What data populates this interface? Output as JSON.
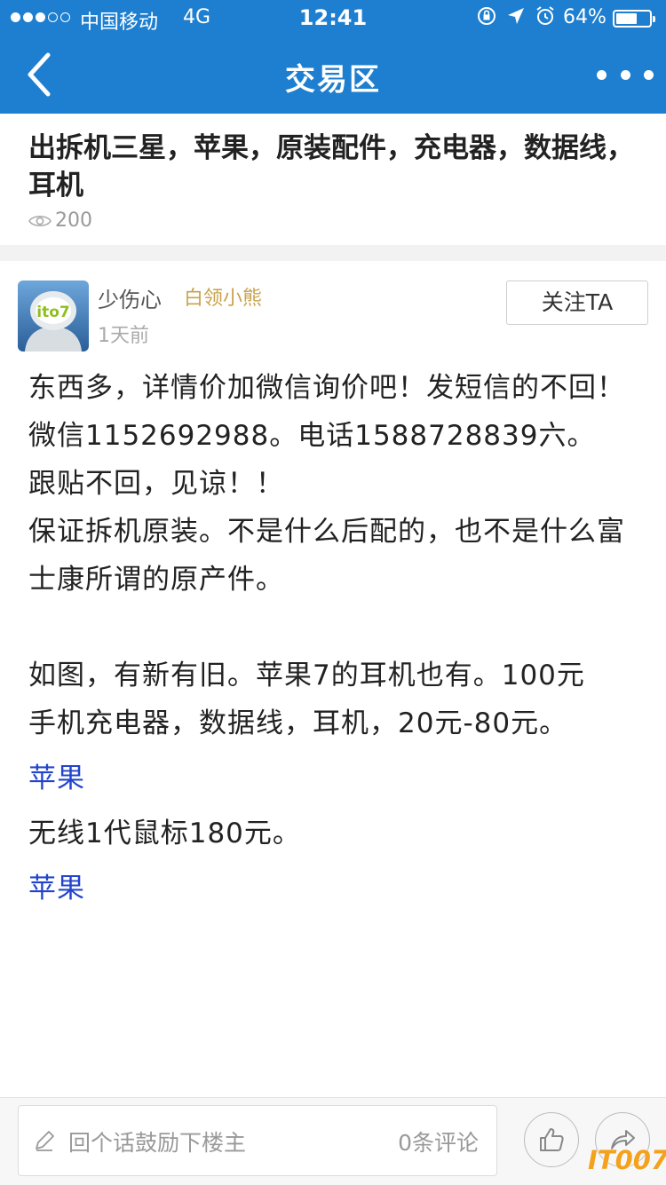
{
  "status_bar": {
    "carrier": "中国移动",
    "network": "4G",
    "time": "12:41",
    "battery_pct": "64%",
    "battery_level": 0.64,
    "icons": [
      "orientation-lock-icon",
      "location-arrow-icon",
      "alarm-icon"
    ]
  },
  "nav": {
    "title": "交易区",
    "back_icon": "chevron-left-icon",
    "more_icon": "more-dots-icon"
  },
  "post": {
    "title": "出拆机三星，苹果，原装配件，充电器，数据线，耳机",
    "views": "200",
    "author": {
      "name": "少伤心",
      "level": "白领小熊",
      "time": "1天前",
      "avatar_text": "ito7",
      "follow_label": "关注TA"
    },
    "content": {
      "l1": "东西多，详情价加微信询价吧！发短信的不回！",
      "l2": "微信1152692988。电话1588728839六。",
      "l3": "跟贴不回，见谅！！",
      "l4": "保证拆机原装。不是什么后配的，也不是什么富士康所谓的原产件。",
      "l5": "如图，有新有旧。苹果7的耳机也有。100元",
      "l6": "手机充电器，数据线，耳机，20元-80元。",
      "link1": "苹果",
      "l7": "无线1代鼠标180元。",
      "link2": "苹果"
    }
  },
  "bottom": {
    "comment_placeholder": "回个话鼓励下楼主",
    "comment_count": "0条评论",
    "like_icon": "thumbs-up-icon",
    "share_icon": "share-icon",
    "watermark": "IT007"
  },
  "colors": {
    "nav_bg": "#1e7fd0",
    "link": "#2244cc",
    "level": "#c9a24a",
    "watermark": "#f4a21d"
  }
}
